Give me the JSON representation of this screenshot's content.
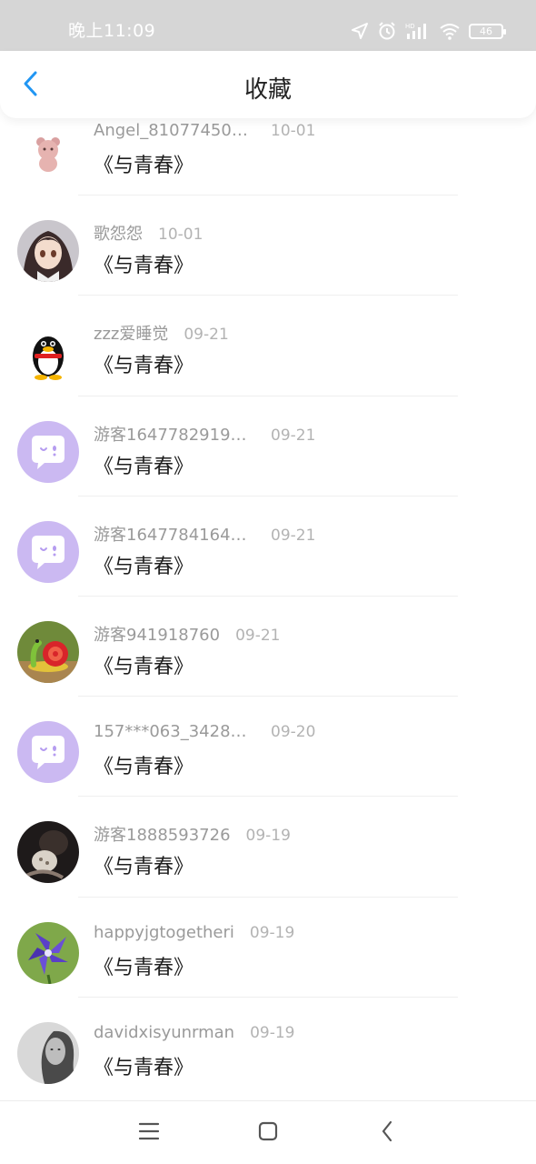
{
  "status_bar": {
    "time": "晚上11:09",
    "battery": "46",
    "icons": [
      "location-icon",
      "alarm-icon",
      "signal-icon",
      "wifi-icon",
      "battery-icon"
    ]
  },
  "header": {
    "title": "收藏",
    "back_icon": "chevron-left-icon",
    "accent_color": "#2196f3"
  },
  "favorites": [
    {
      "name": "Angel_810774506...",
      "date": "10-01",
      "work": "《与青春》",
      "avatar": "bear-sticker"
    },
    {
      "name": "歌怨怨",
      "date": "10-01",
      "work": "《与青春》",
      "avatar": "anime-girl"
    },
    {
      "name": "zzz爱睡觉",
      "date": "09-21",
      "work": "《与青春》",
      "avatar": "qq-penguin"
    },
    {
      "name": "游客16477829191...",
      "date": "09-21",
      "work": "《与青春》",
      "avatar": "chat-bubble-default"
    },
    {
      "name": "游客16477841645...",
      "date": "09-21",
      "work": "《与青春》",
      "avatar": "chat-bubble-default"
    },
    {
      "name": "游客941918760",
      "date": "09-21",
      "work": "《与青春》",
      "avatar": "snail-toy"
    },
    {
      "name": "157***063_34285...",
      "date": "09-20",
      "work": "《与青春》",
      "avatar": "chat-bubble-default"
    },
    {
      "name": "游客1888593726",
      "date": "09-19",
      "work": "《与青春》",
      "avatar": "dark-photo"
    },
    {
      "name": "happyjgtogetheri",
      "date": "09-19",
      "work": "《与青春》",
      "avatar": "purple-flower"
    },
    {
      "name": "davidxisyunrman",
      "date": "09-19",
      "work": "《与青春》",
      "avatar": "grayscale-portrait"
    }
  ],
  "system_nav": [
    "menu-icon",
    "home-icon",
    "back-icon"
  ]
}
